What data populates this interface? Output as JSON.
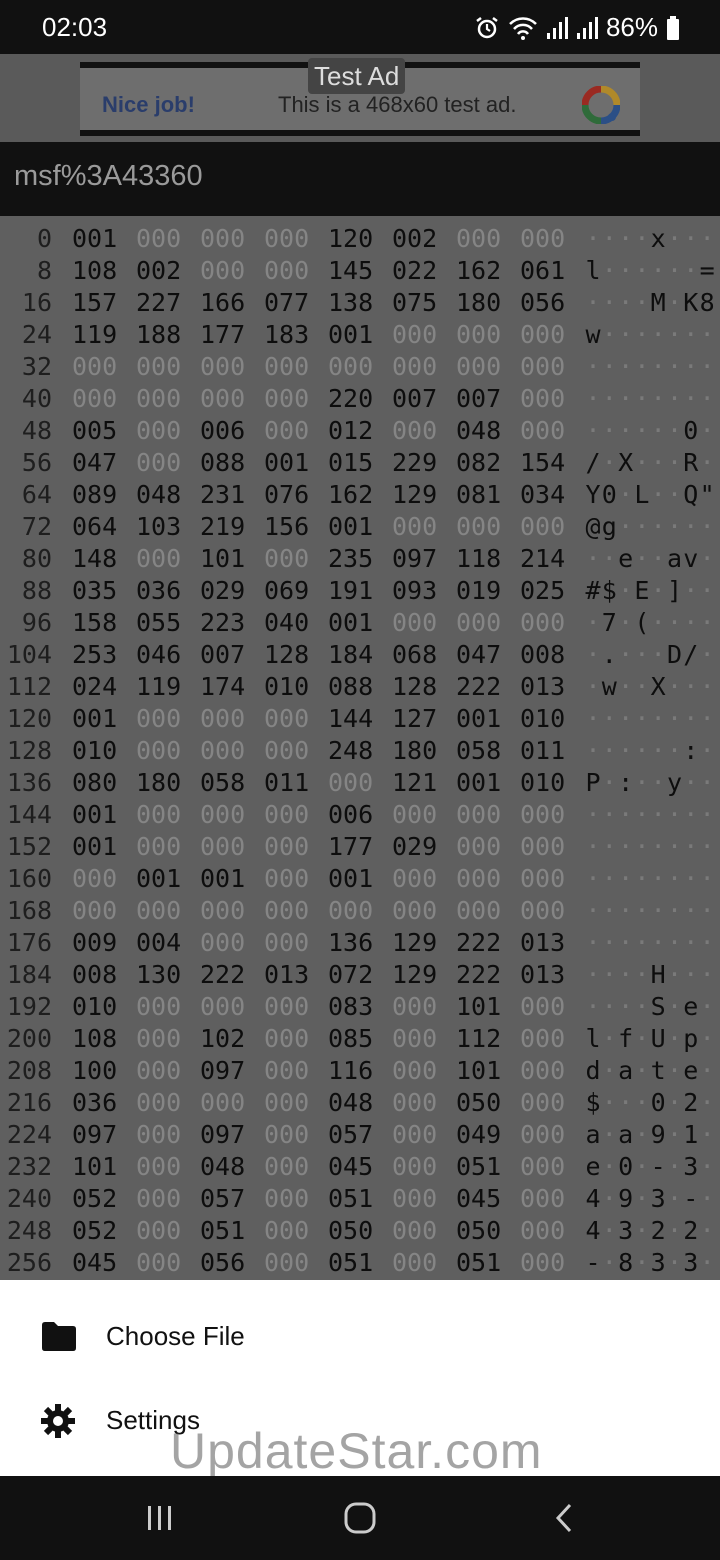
{
  "status_bar": {
    "time": "02:03",
    "battery": "86%",
    "icons": [
      "alarm-icon",
      "wifi-icon",
      "signal-icon",
      "signal-icon",
      "battery-icon"
    ]
  },
  "ad": {
    "label": "Test Ad",
    "left_text": "Nice job!",
    "text": "This is a 468x60 test ad."
  },
  "app_bar": {
    "title": "msf%3A43360"
  },
  "hex": {
    "rows": [
      {
        "offset": "0",
        "bytes": [
          "001",
          "000",
          "000",
          "000",
          "120",
          "002",
          "000",
          "000"
        ],
        "ascii": [
          "·",
          "·",
          "·",
          "·",
          "x",
          "·",
          "·",
          "·"
        ]
      },
      {
        "offset": "8",
        "bytes": [
          "108",
          "002",
          "000",
          "000",
          "145",
          "022",
          "162",
          "061"
        ],
        "ascii": [
          "l",
          "·",
          "·",
          "·",
          "·",
          "·",
          "·",
          "="
        ]
      },
      {
        "offset": "16",
        "bytes": [
          "157",
          "227",
          "166",
          "077",
          "138",
          "075",
          "180",
          "056"
        ],
        "ascii": [
          "·",
          "·",
          "·",
          "·",
          "M",
          "·",
          "K",
          "8"
        ]
      },
      {
        "offset": "24",
        "bytes": [
          "119",
          "188",
          "177",
          "183",
          "001",
          "000",
          "000",
          "000"
        ],
        "ascii": [
          "w",
          "·",
          "·",
          "·",
          "·",
          "·",
          "·",
          "·"
        ]
      },
      {
        "offset": "32",
        "bytes": [
          "000",
          "000",
          "000",
          "000",
          "000",
          "000",
          "000",
          "000"
        ],
        "ascii": [
          "·",
          "·",
          "·",
          "·",
          "·",
          "·",
          "·",
          "·"
        ]
      },
      {
        "offset": "40",
        "bytes": [
          "000",
          "000",
          "000",
          "000",
          "220",
          "007",
          "007",
          "000"
        ],
        "ascii": [
          "·",
          "·",
          "·",
          "·",
          "·",
          "·",
          "·",
          "·"
        ]
      },
      {
        "offset": "48",
        "bytes": [
          "005",
          "000",
          "006",
          "000",
          "012",
          "000",
          "048",
          "000"
        ],
        "ascii": [
          "·",
          "·",
          "·",
          "·",
          "·",
          "·",
          "0",
          "·"
        ]
      },
      {
        "offset": "56",
        "bytes": [
          "047",
          "000",
          "088",
          "001",
          "015",
          "229",
          "082",
          "154"
        ],
        "ascii": [
          "/",
          "·",
          "X",
          "·",
          "·",
          "·",
          "R",
          "·"
        ]
      },
      {
        "offset": "64",
        "bytes": [
          "089",
          "048",
          "231",
          "076",
          "162",
          "129",
          "081",
          "034"
        ],
        "ascii": [
          "Y",
          "0",
          "·",
          "L",
          "·",
          "·",
          "Q",
          "\""
        ]
      },
      {
        "offset": "72",
        "bytes": [
          "064",
          "103",
          "219",
          "156",
          "001",
          "000",
          "000",
          "000"
        ],
        "ascii": [
          "@",
          "g",
          "·",
          "·",
          "·",
          "·",
          "·",
          "·"
        ]
      },
      {
        "offset": "80",
        "bytes": [
          "148",
          "000",
          "101",
          "000",
          "235",
          "097",
          "118",
          "214"
        ],
        "ascii": [
          "·",
          "·",
          "e",
          "·",
          "·",
          "a",
          "v",
          "·"
        ]
      },
      {
        "offset": "88",
        "bytes": [
          "035",
          "036",
          "029",
          "069",
          "191",
          "093",
          "019",
          "025"
        ],
        "ascii": [
          "#",
          "$",
          "·",
          "E",
          "·",
          "]",
          "·",
          "·"
        ]
      },
      {
        "offset": "96",
        "bytes": [
          "158",
          "055",
          "223",
          "040",
          "001",
          "000",
          "000",
          "000"
        ],
        "ascii": [
          "·",
          "7",
          "·",
          "(",
          "·",
          "·",
          "·",
          "·"
        ]
      },
      {
        "offset": "104",
        "bytes": [
          "253",
          "046",
          "007",
          "128",
          "184",
          "068",
          "047",
          "008"
        ],
        "ascii": [
          "·",
          ".",
          "·",
          "·",
          "·",
          "D",
          "/",
          "·"
        ]
      },
      {
        "offset": "112",
        "bytes": [
          "024",
          "119",
          "174",
          "010",
          "088",
          "128",
          "222",
          "013"
        ],
        "ascii": [
          "·",
          "w",
          "·",
          "·",
          "X",
          "·",
          "·",
          "·"
        ]
      },
      {
        "offset": "120",
        "bytes": [
          "001",
          "000",
          "000",
          "000",
          "144",
          "127",
          "001",
          "010"
        ],
        "ascii": [
          "·",
          "·",
          "·",
          "·",
          "·",
          "·",
          "·",
          "·"
        ]
      },
      {
        "offset": "128",
        "bytes": [
          "010",
          "000",
          "000",
          "000",
          "248",
          "180",
          "058",
          "011"
        ],
        "ascii": [
          "·",
          "·",
          "·",
          "·",
          "·",
          "·",
          ":",
          "·"
        ]
      },
      {
        "offset": "136",
        "bytes": [
          "080",
          "180",
          "058",
          "011",
          "000",
          "121",
          "001",
          "010"
        ],
        "ascii": [
          "P",
          "·",
          ":",
          "·",
          "·",
          "y",
          "·",
          "·"
        ]
      },
      {
        "offset": "144",
        "bytes": [
          "001",
          "000",
          "000",
          "000",
          "006",
          "000",
          "000",
          "000"
        ],
        "ascii": [
          "·",
          "·",
          "·",
          "·",
          "·",
          "·",
          "·",
          "·"
        ]
      },
      {
        "offset": "152",
        "bytes": [
          "001",
          "000",
          "000",
          "000",
          "177",
          "029",
          "000",
          "000"
        ],
        "ascii": [
          "·",
          "·",
          "·",
          "·",
          "·",
          "·",
          "·",
          "·"
        ]
      },
      {
        "offset": "160",
        "bytes": [
          "000",
          "001",
          "001",
          "000",
          "001",
          "000",
          "000",
          "000"
        ],
        "ascii": [
          "·",
          "·",
          "·",
          "·",
          "·",
          "·",
          "·",
          "·"
        ]
      },
      {
        "offset": "168",
        "bytes": [
          "000",
          "000",
          "000",
          "000",
          "000",
          "000",
          "000",
          "000"
        ],
        "ascii": [
          "·",
          "·",
          "·",
          "·",
          "·",
          "·",
          "·",
          "·"
        ]
      },
      {
        "offset": "176",
        "bytes": [
          "009",
          "004",
          "000",
          "000",
          "136",
          "129",
          "222",
          "013"
        ],
        "ascii": [
          "·",
          "·",
          "·",
          "·",
          "·",
          "·",
          "·",
          "·"
        ]
      },
      {
        "offset": "184",
        "bytes": [
          "008",
          "130",
          "222",
          "013",
          "072",
          "129",
          "222",
          "013"
        ],
        "ascii": [
          "·",
          "·",
          "·",
          "·",
          "H",
          "·",
          "·",
          "·"
        ]
      },
      {
        "offset": "192",
        "bytes": [
          "010",
          "000",
          "000",
          "000",
          "083",
          "000",
          "101",
          "000"
        ],
        "ascii": [
          "·",
          "·",
          "·",
          "·",
          "S",
          "·",
          "e",
          "·"
        ]
      },
      {
        "offset": "200",
        "bytes": [
          "108",
          "000",
          "102",
          "000",
          "085",
          "000",
          "112",
          "000"
        ],
        "ascii": [
          "l",
          "·",
          "f",
          "·",
          "U",
          "·",
          "p",
          "·"
        ]
      },
      {
        "offset": "208",
        "bytes": [
          "100",
          "000",
          "097",
          "000",
          "116",
          "000",
          "101",
          "000"
        ],
        "ascii": [
          "d",
          "·",
          "a",
          "·",
          "t",
          "·",
          "e",
          "·"
        ]
      },
      {
        "offset": "216",
        "bytes": [
          "036",
          "000",
          "000",
          "000",
          "048",
          "000",
          "050",
          "000"
        ],
        "ascii": [
          "$",
          "·",
          "·",
          "·",
          "0",
          "·",
          "2",
          "·"
        ]
      },
      {
        "offset": "224",
        "bytes": [
          "097",
          "000",
          "097",
          "000",
          "057",
          "000",
          "049",
          "000"
        ],
        "ascii": [
          "a",
          "·",
          "a",
          "·",
          "9",
          "·",
          "1",
          "·"
        ]
      },
      {
        "offset": "232",
        "bytes": [
          "101",
          "000",
          "048",
          "000",
          "045",
          "000",
          "051",
          "000"
        ],
        "ascii": [
          "e",
          "·",
          "0",
          "·",
          "-",
          "·",
          "3",
          "·"
        ]
      },
      {
        "offset": "240",
        "bytes": [
          "052",
          "000",
          "057",
          "000",
          "051",
          "000",
          "045",
          "000"
        ],
        "ascii": [
          "4",
          "·",
          "9",
          "·",
          "3",
          "·",
          "-",
          "·"
        ]
      },
      {
        "offset": "248",
        "bytes": [
          "052",
          "000",
          "051",
          "000",
          "050",
          "000",
          "050",
          "000"
        ],
        "ascii": [
          "4",
          "·",
          "3",
          "·",
          "2",
          "·",
          "2",
          "·"
        ]
      },
      {
        "offset": "256",
        "bytes": [
          "045",
          "000",
          "056",
          "000",
          "051",
          "000",
          "051",
          "000"
        ],
        "ascii": [
          "-",
          "·",
          "8",
          "·",
          "3",
          "·",
          "3",
          "·"
        ]
      }
    ]
  },
  "menu": {
    "items": [
      {
        "label": "Choose File",
        "icon": "folder-icon"
      },
      {
        "label": "Settings",
        "icon": "gear-icon"
      }
    ]
  },
  "watermark": "UpdateStar.com",
  "nav": {
    "icons": [
      "recents-icon",
      "home-icon",
      "back-icon"
    ]
  }
}
